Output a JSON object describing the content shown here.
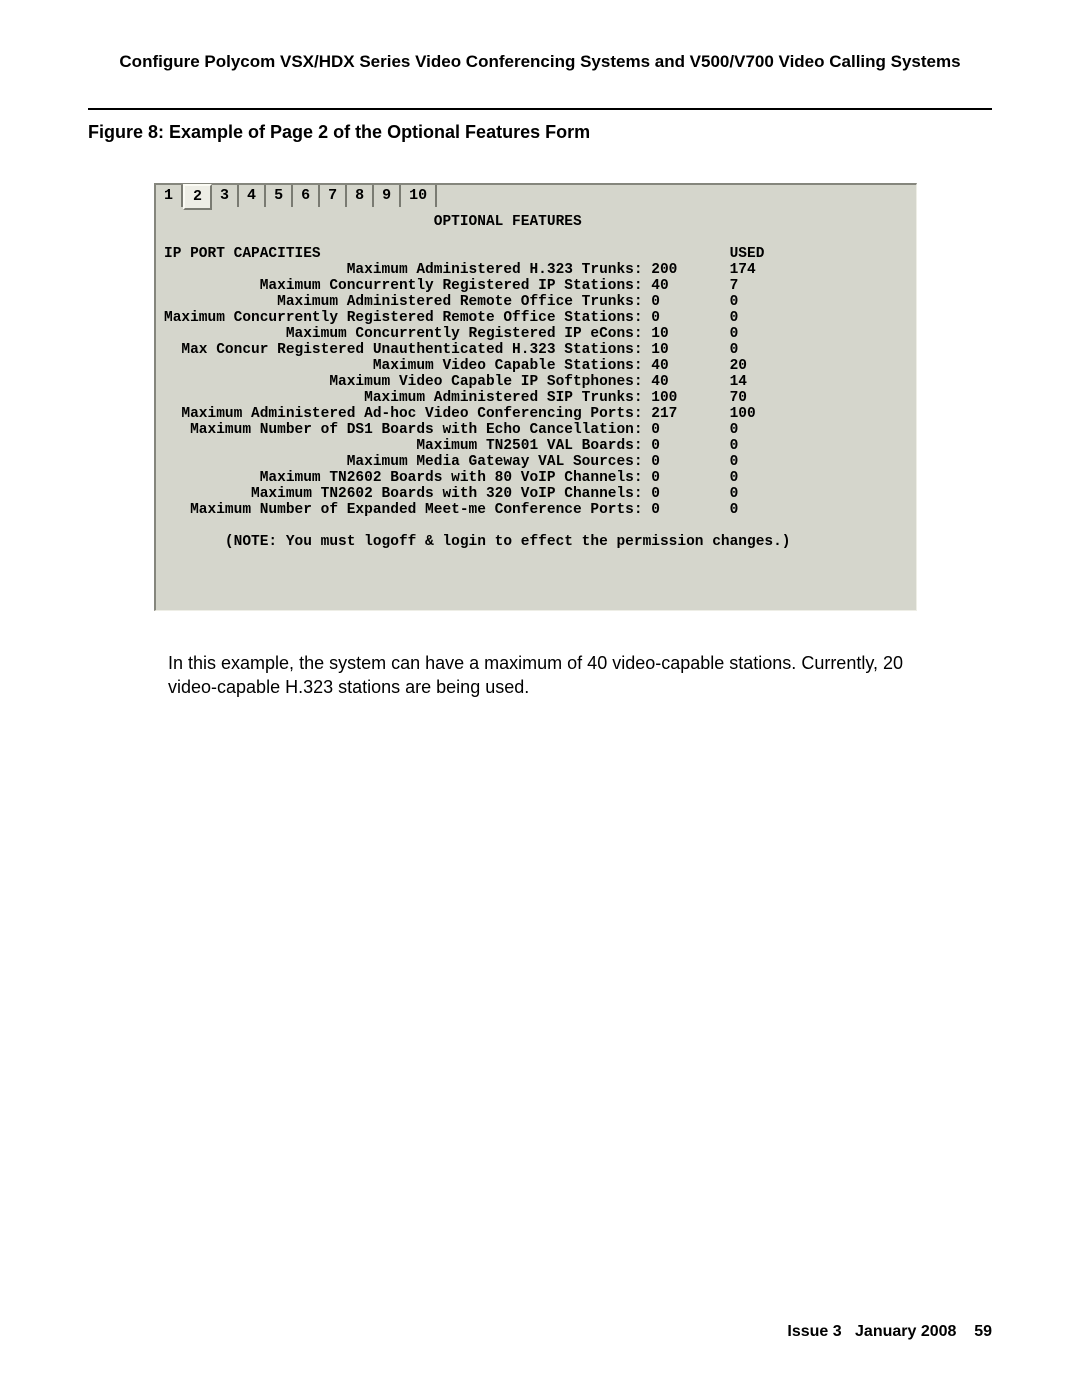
{
  "header": {
    "title": "Configure Polycom VSX/HDX Series Video Conferencing Systems and V500/V700 Video Calling Systems"
  },
  "figure": {
    "caption": "Figure 8: Example of Page 2 of the Optional Features Form"
  },
  "terminal": {
    "tabs": [
      "1",
      "2",
      "3",
      "4",
      "5",
      "6",
      "7",
      "8",
      "9",
      "10"
    ],
    "active_tab_index": 1,
    "title": "OPTIONAL FEATURES",
    "section_heading": "IP PORT CAPACITIES",
    "used_header": "USED",
    "rows": [
      {
        "label": "Maximum Administered H.323 Trunks:",
        "capacity": "200",
        "used": "174"
      },
      {
        "label": "Maximum Concurrently Registered IP Stations:",
        "capacity": "40",
        "used": "7"
      },
      {
        "label": "Maximum Administered Remote Office Trunks:",
        "capacity": "0",
        "used": "0"
      },
      {
        "label": "Maximum Concurrently Registered Remote Office Stations:",
        "capacity": "0",
        "used": "0"
      },
      {
        "label": "Maximum Concurrently Registered IP eCons:",
        "capacity": "10",
        "used": "0"
      },
      {
        "label": "Max Concur Registered Unauthenticated H.323 Stations:",
        "capacity": "10",
        "used": "0"
      },
      {
        "label": "Maximum Video Capable Stations:",
        "capacity": "40",
        "used": "20"
      },
      {
        "label": "Maximum Video Capable IP Softphones:",
        "capacity": "40",
        "used": "14"
      },
      {
        "label": "Maximum Administered SIP Trunks:",
        "capacity": "100",
        "used": "70"
      },
      {
        "label": "Maximum Administered Ad-hoc Video Conferencing Ports:",
        "capacity": "217",
        "used": "100"
      },
      {
        "label": "Maximum Number of DS1 Boards with Echo Cancellation:",
        "capacity": "0",
        "used": "0"
      },
      {
        "label": "Maximum TN2501 VAL Boards:",
        "capacity": "0",
        "used": "0"
      },
      {
        "label": "Maximum Media Gateway VAL Sources:",
        "capacity": "0",
        "used": "0"
      },
      {
        "label": "Maximum TN2602 Boards with 80 VoIP Channels:",
        "capacity": "0",
        "used": "0"
      },
      {
        "label": "Maximum TN2602 Boards with 320 VoIP Channels:",
        "capacity": "0",
        "used": "0"
      },
      {
        "label": "Maximum Number of Expanded Meet-me Conference Ports:",
        "capacity": "0",
        "used": "0"
      }
    ],
    "note": "(NOTE: You must logoff & login to effect the permission changes.)"
  },
  "body_paragraph": "In this example, the system can have a maximum of 40 video-capable stations. Currently, 20 video-capable H.323 stations are being used.",
  "footer": {
    "issue": "Issue 3",
    "date": "January 2008",
    "page": "59"
  }
}
